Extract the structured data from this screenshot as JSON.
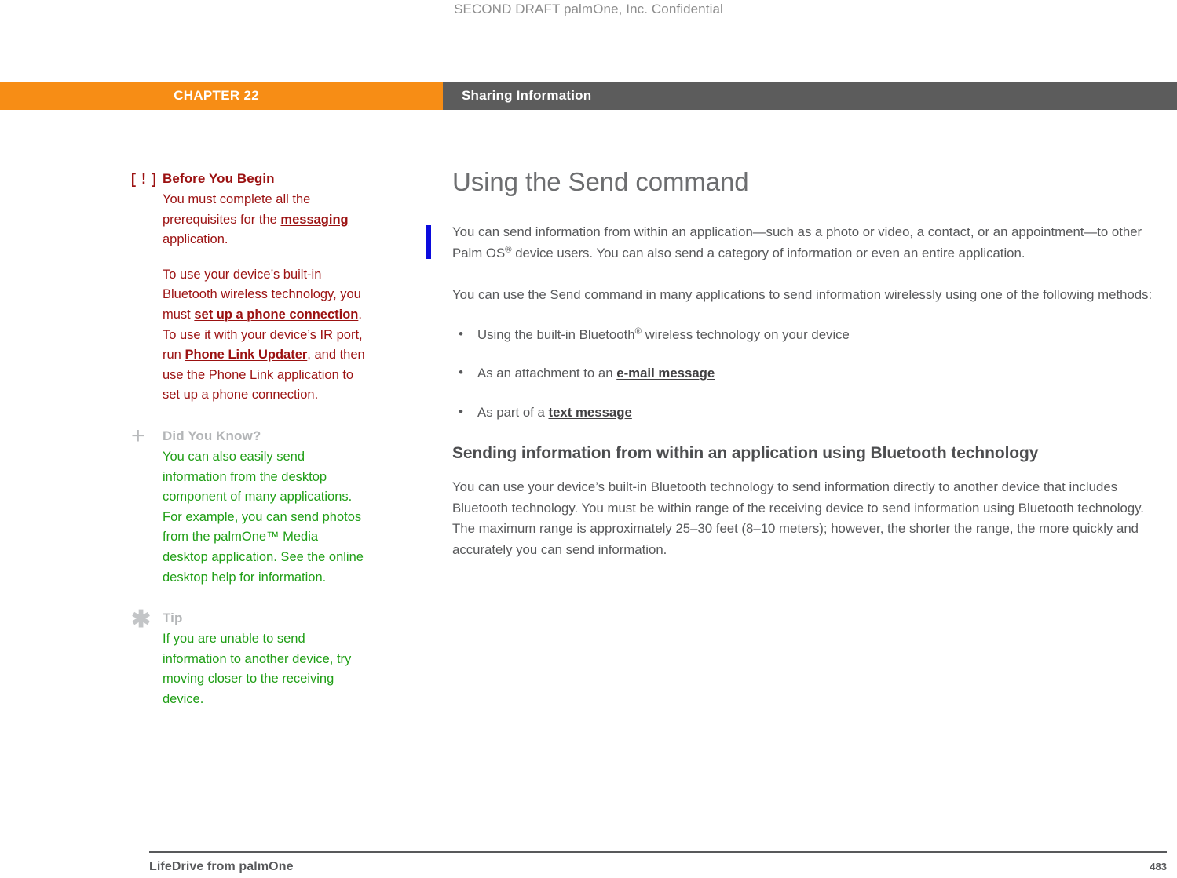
{
  "draft_header": "SECOND DRAFT palmOne, Inc.  Confidential",
  "banner": {
    "chapter_label": "CHAPTER 22",
    "section_label": "Sharing Information",
    "chapter_bg": "#F78D15",
    "section_bg": "#5C5C5C"
  },
  "sidebar": {
    "notes": [
      {
        "icon": "warning-icon",
        "icon_glyph": "[ ! ]",
        "title": "Before You Begin",
        "title_color": "#9B1111",
        "body_color": "#9B1111",
        "paragraphs": [
          {
            "segments": [
              {
                "text": "You must complete all the prerequisites for the ",
                "style": "plain"
              },
              {
                "text": "messaging",
                "style": "link"
              },
              {
                "text": " application.",
                "style": "plain"
              }
            ]
          },
          {
            "segments": [
              {
                "text": "To use your device’s built-in Bluetooth wireless technology, you must ",
                "style": "plain"
              },
              {
                "text": "set up a phone connection",
                "style": "link"
              },
              {
                "text": ". To use it with your device’s IR port, run ",
                "style": "plain"
              },
              {
                "text": "Phone Link Updater",
                "style": "link"
              },
              {
                "text": ", and then use the Phone Link application to set up a phone connection.",
                "style": "plain"
              }
            ]
          }
        ]
      },
      {
        "icon": "plus-icon",
        "icon_glyph": "+",
        "title": "Did You Know?",
        "title_color": "#B3B5B7",
        "body_color": "#1F9E15",
        "paragraphs": [
          {
            "segments": [
              {
                "text": "You can also easily send information from the desktop component of many applications. For example, you can send photos from the palmOne™ Media desktop application. See the online desktop help for information.",
                "style": "plain"
              }
            ]
          }
        ]
      },
      {
        "icon": "asterisk-icon",
        "icon_glyph": "✱",
        "title": "Tip",
        "title_color": "#C3C5C7",
        "body_color": "#1F9E15",
        "paragraphs": [
          {
            "segments": [
              {
                "text": "If you are unable to send information to another device, try moving closer to the receiving device.",
                "style": "plain"
              }
            ]
          }
        ]
      }
    ]
  },
  "main": {
    "heading": "Using the Send command",
    "intro_paragraph_1a": "You can send information from within an application—such as a photo or video, a contact, or an appointment—to other Palm OS",
    "intro_paragraph_1_sup": "®",
    "intro_paragraph_1b": " device users. You can also send a category of information or even an entire application.",
    "intro_paragraph_2": "You can use the Send command in many applications to send information wirelessly using one of the following methods:",
    "bullets": [
      {
        "pre": "Using the built-in Bluetooth",
        "sup": "®",
        "post": " wireless technology on your device",
        "link": ""
      },
      {
        "pre": "As an attachment to an ",
        "sup": "",
        "post": "",
        "link": "e-mail message"
      },
      {
        "pre": "As part of a ",
        "sup": "",
        "post": "",
        "link": "text message"
      }
    ],
    "subheading": "Sending information from within an application using Bluetooth technology",
    "body_paragraph": "You can use your device’s built-in Bluetooth technology to send information directly to another device that includes Bluetooth technology. You must be within range of the receiving device to send information using Bluetooth technology. The maximum range is approximately 25–30 feet (8–10 meters); however, the shorter the range, the more quickly and accurately you can send information.",
    "change_bar_color": "#0B0BDD"
  },
  "footer": {
    "product": "LifeDrive from palmOne",
    "page_number": "483"
  }
}
